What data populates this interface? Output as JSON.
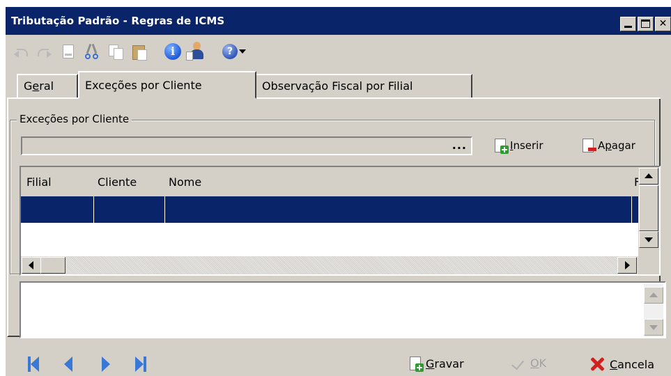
{
  "window": {
    "title": "Tributação Padrão - Regras de ICMS"
  },
  "toolbar": {
    "icons": [
      "undo-icon",
      "redo-icon",
      "new-document-icon",
      "cut-icon",
      "copy-icon",
      "paste-icon",
      "info-icon",
      "user-document-icon",
      "help-icon",
      "dropdown-arrow-icon"
    ],
    "info_glyph": "i",
    "help_glyph": "?"
  },
  "tabs": [
    {
      "label_pre": "G",
      "label_u": "e",
      "label_post": "ral",
      "active": false
    },
    {
      "label": "Exceções por Cliente",
      "active": true
    },
    {
      "label": "Observação Fiscal por Filial",
      "active": false
    }
  ],
  "group": {
    "legend": "Exceções por Cliente",
    "lookup_button": "..."
  },
  "actions": {
    "insert": {
      "u": "I",
      "rest": "nserir"
    },
    "delete": {
      "pre": "A",
      "u": "p",
      "rest": "agar"
    }
  },
  "grid": {
    "columns": [
      "Filial",
      "Cliente",
      "Nome",
      "F"
    ],
    "selected_row_color": "#0a246a"
  },
  "bottom": {
    "save": {
      "u": "G",
      "rest": "ravar"
    },
    "ok": {
      "u": "O",
      "rest": "K"
    },
    "cancel": {
      "u": "C",
      "rest": "ancela"
    }
  },
  "colors": {
    "titlebar": "#0a246a",
    "face": "#d4d0c8",
    "nav_blue": "#3a78d6",
    "cancel_red": "#d02020"
  }
}
